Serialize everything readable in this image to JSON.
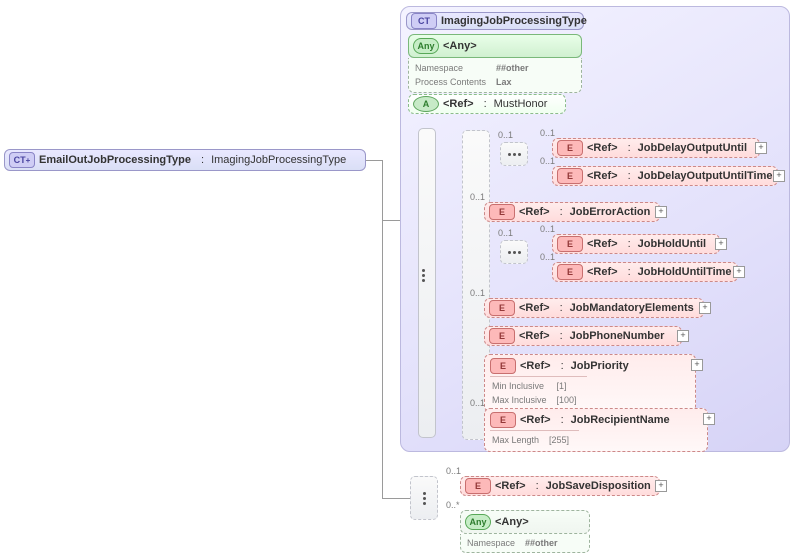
{
  "root": {
    "ct": "CT",
    "plus": "+",
    "name": "EmailOutJobProcessingType",
    "colon": ":",
    "base": "ImagingJobProcessingType"
  },
  "panel": {
    "ct": "CT",
    "title": "ImagingJobProcessingType"
  },
  "any": {
    "tag": "Any",
    "label": "<Any>",
    "ns_k": "Namespace",
    "ns_v": "##other",
    "pc_k": "Process Contents",
    "pc_v": "Lax"
  },
  "must": {
    "a": "A",
    "ref": "<Ref>",
    "colon": ":",
    "name": "MustHonor"
  },
  "occ": {
    "z1": "0..1",
    "zs": "0..*"
  },
  "e": {
    "tag": "E",
    "ref": "<Ref>",
    "colon": ":"
  },
  "el": {
    "jdou": "JobDelayOutputUntil",
    "jdout": "JobDelayOutputUntilTime",
    "jea": "JobErrorAction",
    "jhu": "JobHoldUntil",
    "jhut": "JobHoldUntilTime",
    "jme": "JobMandatoryElements",
    "jpn": "JobPhoneNumber",
    "jp": "JobPriority",
    "jrn": "JobRecipientName",
    "jsd": "JobSaveDisposition"
  },
  "meta": {
    "mininc_k": "Min Inclusive",
    "mininc_v": "[1]",
    "maxinc_k": "Max Inclusive",
    "maxinc_v": "[100]",
    "maxlen_k": "Max Length",
    "maxlen_v": "[255]"
  },
  "bottomAny": {
    "tag": "Any",
    "label": "<Any>",
    "ns_k": "Namespace",
    "ns_v": "##other"
  }
}
